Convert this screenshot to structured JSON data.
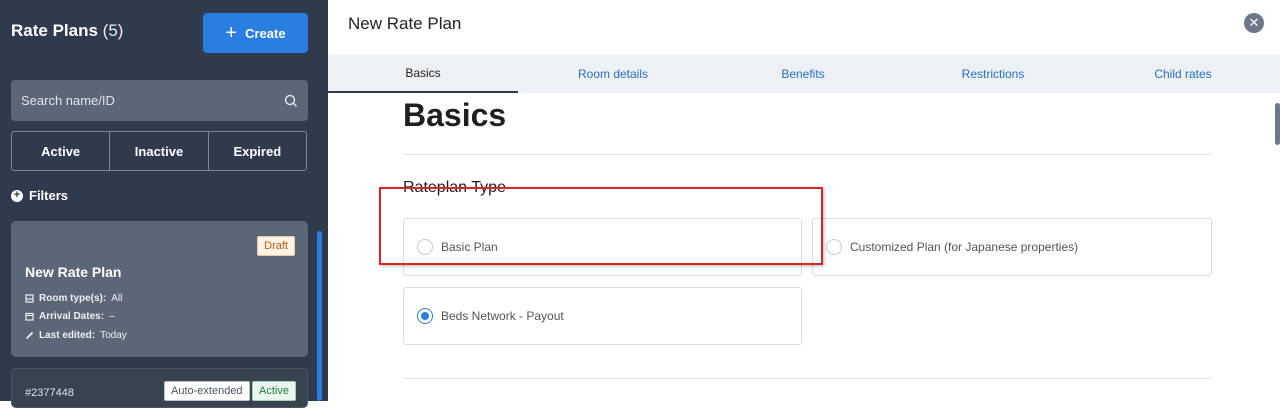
{
  "sidebar": {
    "title": "Rate Plans",
    "count": "(5)",
    "create_label": "Create",
    "search_placeholder": "Search name/ID",
    "segments": [
      "Active",
      "Inactive",
      "Expired"
    ],
    "filters_label": "Filters",
    "cards": [
      {
        "badge": "Draft",
        "title": "New Rate Plan",
        "room_types_label": "Room type(s):",
        "room_types_value": "All",
        "arrival_label": "Arrival Dates:",
        "arrival_value": "–",
        "edited_label": "Last edited:",
        "edited_value": "Today"
      },
      {
        "id": "#2377448",
        "badge_auto": "Auto-extended",
        "badge_status": "Active"
      }
    ]
  },
  "modal": {
    "title": "New Rate Plan",
    "tabs": [
      "Basics",
      "Room details",
      "Benefits",
      "Restrictions",
      "Child rates"
    ],
    "active_tab": "Basics",
    "heading": "Basics",
    "section_title": "Rateplan Type",
    "options": [
      {
        "label": "Basic Plan",
        "selected": false
      },
      {
        "label": "Customized Plan (for Japanese properties)",
        "selected": false
      },
      {
        "label": "Beds Network - Payout",
        "selected": true
      }
    ]
  },
  "colors": {
    "sidebar_bg": "#2f3b4c",
    "accent": "#2a7de1",
    "highlight": "#d22a2a"
  }
}
